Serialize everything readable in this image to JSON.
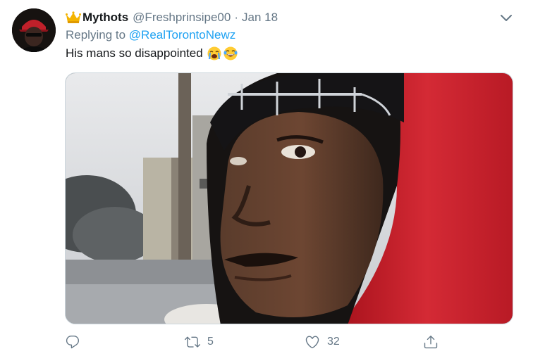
{
  "tweet": {
    "display_name": "Mythots",
    "handle": "@Freshprinsipe00",
    "separator": "·",
    "timestamp": "Jan 18",
    "replying_prefix": "Replying to",
    "replying_to": "@RealTorontoNewz",
    "text": "His mans so disappointed",
    "emojis": [
      "loudly-crying-face",
      "face-with-tears-of-joy"
    ],
    "media": "video-still"
  },
  "actions": {
    "reply_count": "",
    "retweet_count": "5",
    "like_count": "32"
  },
  "colors": {
    "primary_text": "#14171a",
    "secondary_text": "#657786",
    "link": "#1da1f2",
    "border": "#ccd6dd",
    "hood_red": "#c0202a"
  },
  "icons": [
    "crown-icon",
    "chevron-down-icon",
    "reply-icon",
    "retweet-icon",
    "like-icon",
    "share-icon"
  ]
}
